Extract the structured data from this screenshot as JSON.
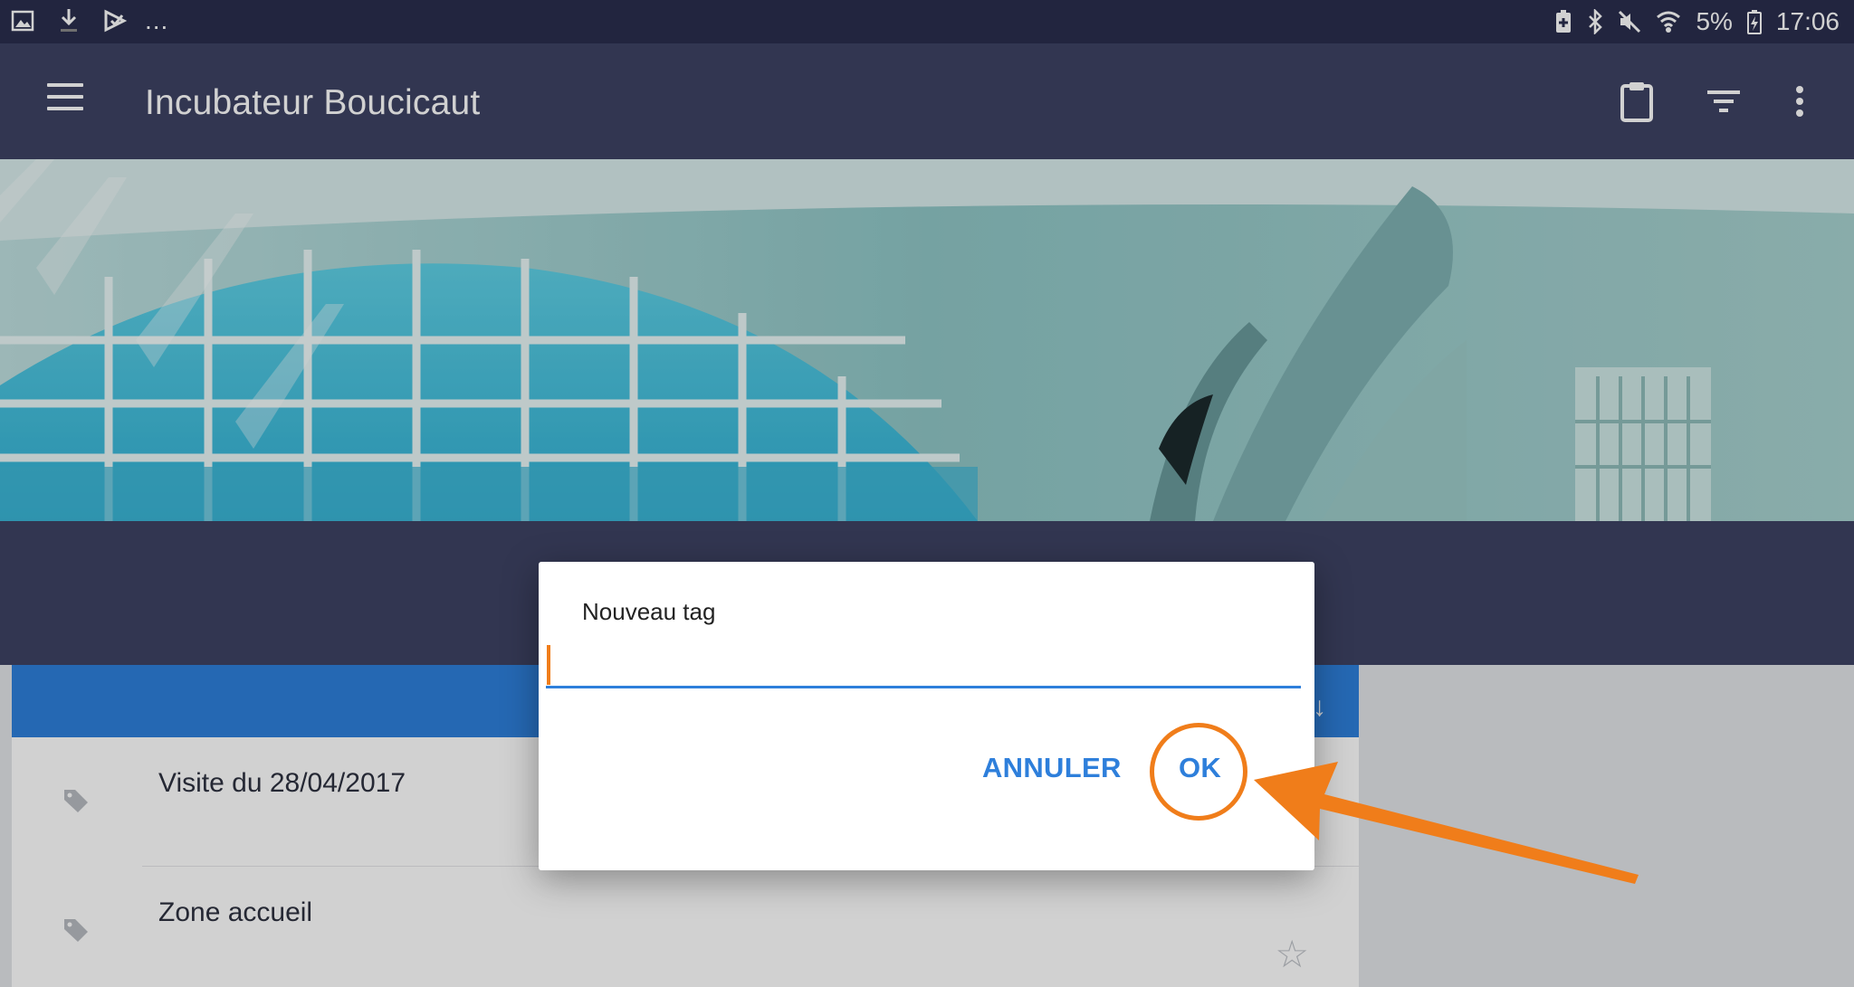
{
  "status_bar": {
    "battery_text": "5%",
    "time": "17:06",
    "overflow_dots": "..."
  },
  "app_bar": {
    "title": "Incubateur Boucicaut"
  },
  "list": {
    "items": [
      {
        "title": "Visite du 28/04/2017"
      },
      {
        "title": "Zone accueil"
      }
    ]
  },
  "dialog": {
    "title": "Nouveau tag",
    "input_value": "",
    "cancel_label": "ANNULER",
    "ok_label": "OK"
  },
  "colors": {
    "status_bar": "#2a2e4d",
    "app_bar": "#3e4263",
    "accent_blue": "#2e7fdb",
    "highlight_orange": "#f07d1a"
  }
}
